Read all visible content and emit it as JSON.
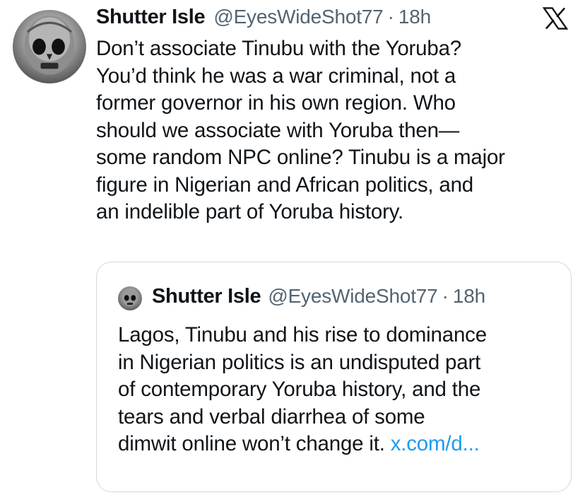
{
  "tweet": {
    "author_name": "Shutter Isle",
    "handle": "@EyesWideShot77",
    "separator": "·",
    "time": "18h",
    "lines": [
      "Don’t associate Tinubu with the Yoruba?",
      "You’d think he was a war criminal, not a",
      "former governor in his own region. Who",
      "should we associate with Yoruba then—",
      "some random NPC online? Tinubu is a major",
      "figure in Nigerian and African politics, and",
      "an indelible part of Yoruba history."
    ]
  },
  "quoted_tweet": {
    "author_name": "Shutter Isle",
    "handle": "@EyesWideShot77",
    "separator": "·",
    "time": "18h",
    "lines": [
      "Lagos, Tinubu and his rise to dominance",
      "in Nigerian politics is an undisputed part",
      "of contemporary Yoruba history, and the",
      "tears and verbal diarrhea of some",
      "dimwit online won’t change it."
    ],
    "link_text": "x.com/d..."
  },
  "icons": {
    "avatar": "skull-face-avatar-icon",
    "logo": "x-logo-icon"
  },
  "colors": {
    "text": "#0f1419",
    "secondary": "#536471",
    "link": "#1d9bf0",
    "border": "#cfd9de"
  }
}
